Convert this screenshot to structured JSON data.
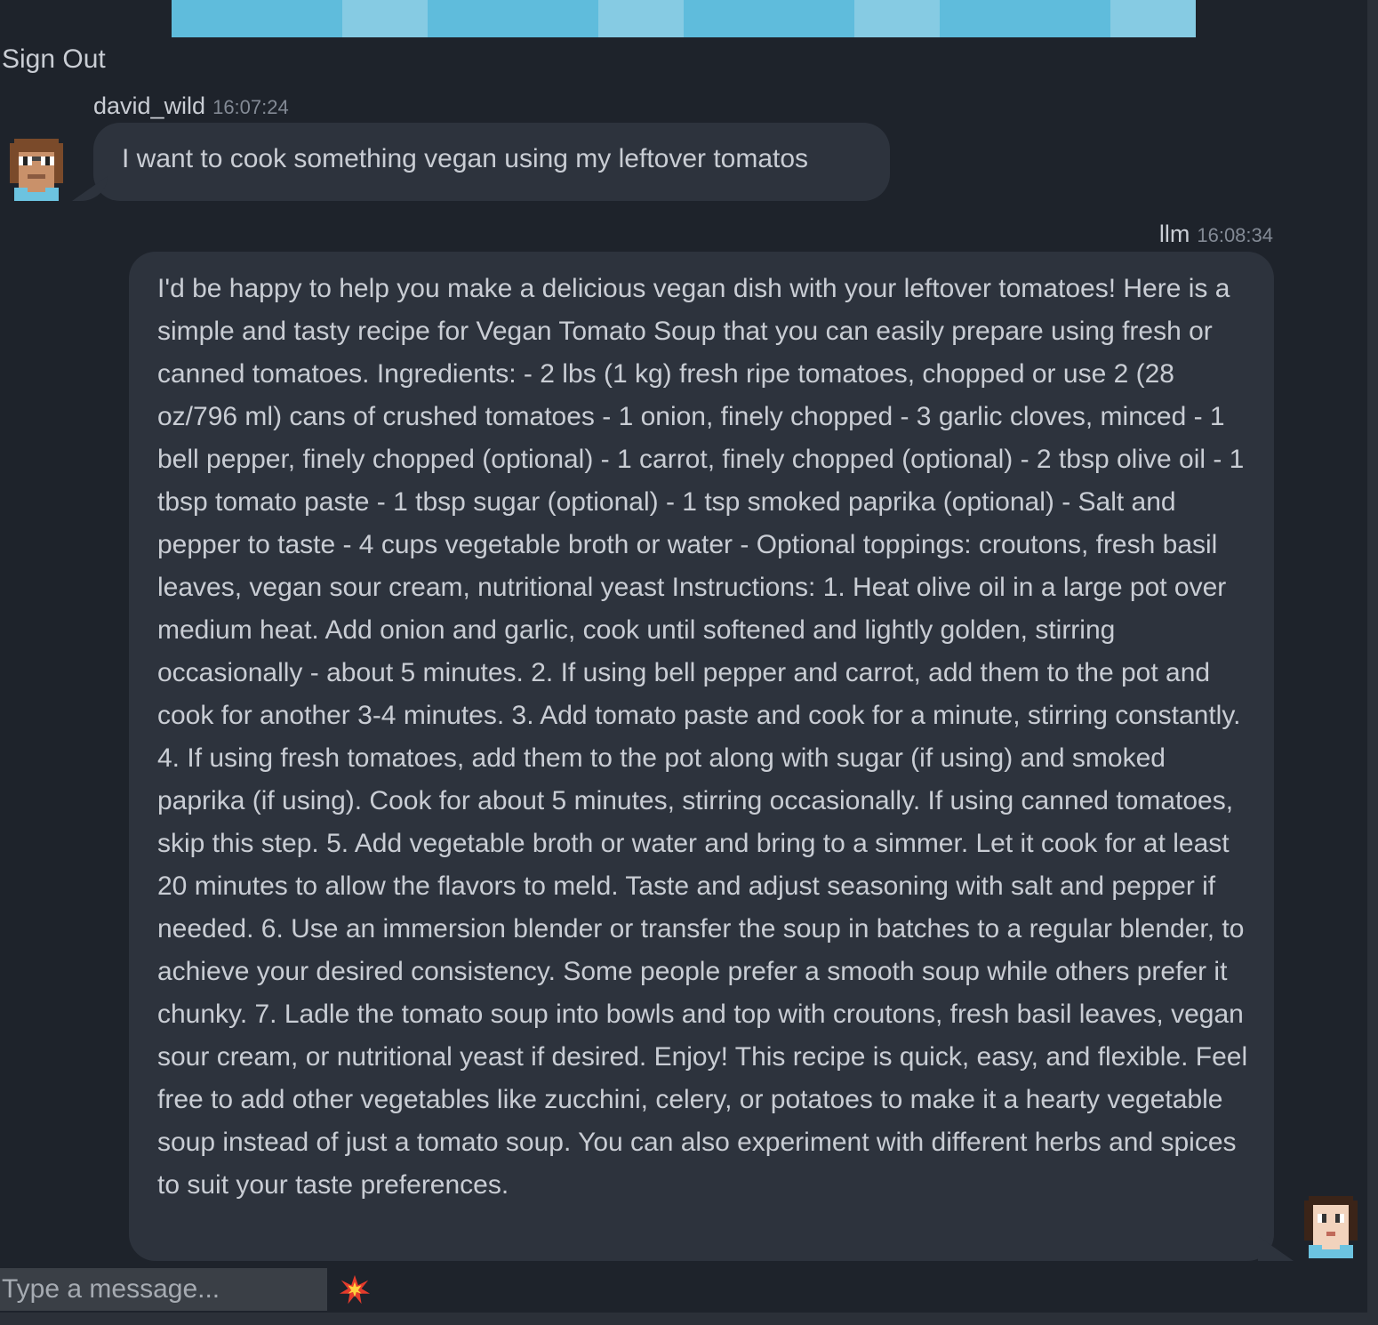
{
  "header": {
    "sign_out_label": "Sign Out",
    "strip_colors": [
      "#5fbcdc",
      "#86cbe3",
      "#5fbcdc",
      "#86cbe3",
      "#5fbcdc",
      "#86cbe3",
      "#5fbcdc",
      "#86cbe3"
    ]
  },
  "messages": [
    {
      "author": "david_wild",
      "time": "16:07:24",
      "text": "I want to cook something vegan using my leftover tomatos",
      "avatar_icon": "user-pixel-avatar-icon"
    },
    {
      "author": "llm",
      "time": "16:08:34",
      "text": "I'd be happy to help you make a delicious vegan dish with your leftover tomatoes! Here is a simple and tasty recipe for Vegan Tomato Soup that you can easily prepare using fresh or canned tomatoes. Ingredients: - 2 lbs (1 kg) fresh ripe tomatoes, chopped or use 2 (28 oz/796 ml) cans of crushed tomatoes - 1 onion, finely chopped - 3 garlic cloves, minced - 1 bell pepper, finely chopped (optional) - 1 carrot, finely chopped (optional) - 2 tbsp olive oil - 1 tbsp tomato paste - 1 tbsp sugar (optional) - 1 tsp smoked paprika (optional) - Salt and pepper to taste - 4 cups vegetable broth or water - Optional toppings: croutons, fresh basil leaves, vegan sour cream, nutritional yeast Instructions: 1. Heat olive oil in a large pot over medium heat. Add onion and garlic, cook until softened and lightly golden, stirring occasionally - about 5 minutes. 2. If using bell pepper and carrot, add them to the pot and cook for another 3-4 minutes. 3. Add tomato paste and cook for a minute, stirring constantly. 4. If using fresh tomatoes, add them to the pot along with sugar (if using) and smoked paprika (if using). Cook for about 5 minutes, stirring occasionally. If using canned tomatoes, skip this step. 5. Add vegetable broth or water and bring to a simmer. Let it cook for at least 20 minutes to allow the flavors to meld. Taste and adjust seasoning with salt and pepper if needed. 6. Use an immersion blender or transfer the soup in batches to a regular blender, to achieve your desired consistency. Some people prefer a smooth soup while others prefer it chunky. 7. Ladle the tomato soup into bowls and top with croutons, fresh basil leaves, vegan sour cream, or nutritional yeast if desired. Enjoy! This recipe is quick, easy, and flexible. Feel free to add other vegetables like zucchini, celery, or potatoes to make it a hearty vegetable soup instead of just a tomato soup. You can also experiment with different herbs and spices to suit your taste preferences.",
      "avatar_icon": "llm-pixel-avatar-icon"
    }
  ],
  "composer": {
    "placeholder": "Type a message...",
    "emoji_icon": "collision-emoji-icon"
  },
  "colors": {
    "background": "#1e232b",
    "bubble": "#2d333d",
    "text": "#c9cdd4",
    "timestamp": "#838a95",
    "input": "#3a3f46"
  }
}
